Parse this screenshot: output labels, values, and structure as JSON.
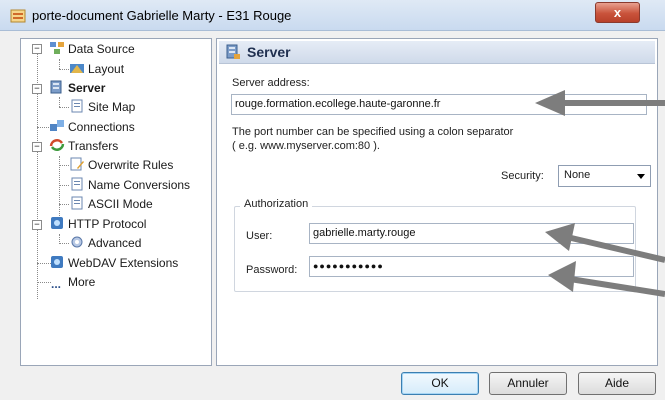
{
  "window": {
    "title": "porte-document Gabrielle Marty - E31 Rouge",
    "close_glyph": "x"
  },
  "tree": {
    "items": [
      {
        "label": "Data Source",
        "icon": "data-source-icon"
      },
      {
        "label": "Layout",
        "icon": "layout-icon"
      },
      {
        "label": "Server",
        "icon": "server-icon",
        "selected": true
      },
      {
        "label": "Site Map",
        "icon": "page-icon"
      },
      {
        "label": "Connections",
        "icon": "connections-icon"
      },
      {
        "label": "Transfers",
        "icon": "transfers-icon"
      },
      {
        "label": "Overwrite Rules",
        "icon": "page-edit-icon"
      },
      {
        "label": "Name Conversions",
        "icon": "page-icon"
      },
      {
        "label": "ASCII Mode",
        "icon": "page-icon"
      },
      {
        "label": "HTTP Protocol",
        "icon": "http-icon"
      },
      {
        "label": "Advanced",
        "icon": "advanced-icon"
      },
      {
        "label": "WebDAV Extensions",
        "icon": "webdav-icon"
      },
      {
        "label": "More",
        "icon": "more-icon"
      }
    ],
    "more_glyph": "..."
  },
  "server_panel": {
    "title": "Server",
    "address_label": "Server address:",
    "address_value": "rouge.formation.ecollege.haute-garonne.fr",
    "port_hint_line1": "The port number can be specified using a colon separator",
    "port_hint_line2": "( e.g. www.myserver.com:80 ).",
    "security_label": "Security:",
    "security_value": "None",
    "authorization": {
      "legend": "Authorization",
      "user_label": "User:",
      "user_value": "gabrielle.marty.rouge",
      "password_label": "Password:",
      "password_value": "●●●●●●●●●●●"
    }
  },
  "buttons": {
    "ok": "OK",
    "cancel": "Annuler",
    "help": "Aide"
  },
  "colors": {
    "annotation_arrow": "#7d7d7d",
    "close_button": "#c9533b",
    "selection": "#dde6f4"
  }
}
